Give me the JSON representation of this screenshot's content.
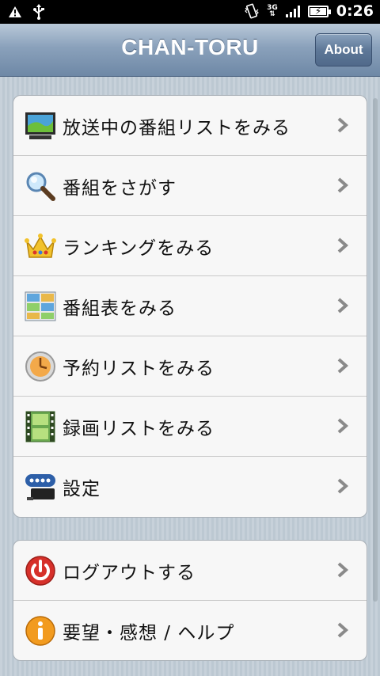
{
  "statusbar": {
    "time": "0:26",
    "network": "3G",
    "left_icons": [
      "warning-icon",
      "usb-icon"
    ],
    "right_icons": [
      "vibrate-icon",
      "network-icon",
      "signal-icon",
      "battery-charging-icon"
    ]
  },
  "titlebar": {
    "title": "CHAN-TORU",
    "about_label": "About"
  },
  "menu_main": [
    {
      "label": "放送中の番組リストをみる",
      "icon": "tv-icon"
    },
    {
      "label": "番組をさがす",
      "icon": "search-icon"
    },
    {
      "label": "ランキングをみる",
      "icon": "crown-icon"
    },
    {
      "label": "番組表をみる",
      "icon": "program-guide-icon"
    },
    {
      "label": "予約リストをみる",
      "icon": "clock-icon"
    },
    {
      "label": "録画リストをみる",
      "icon": "film-icon"
    },
    {
      "label": "設定",
      "icon": "settings-device-icon"
    }
  ],
  "menu_secondary": [
    {
      "label": "ログアウトする",
      "icon": "power-icon"
    },
    {
      "label": "要望・感想 / ヘルプ",
      "icon": "info-icon"
    }
  ],
  "colors": {
    "title_bar": "#7f97b3",
    "background": "#c2cdd6",
    "card": "#f7f7f7",
    "chevron": "#8a8a8a"
  }
}
